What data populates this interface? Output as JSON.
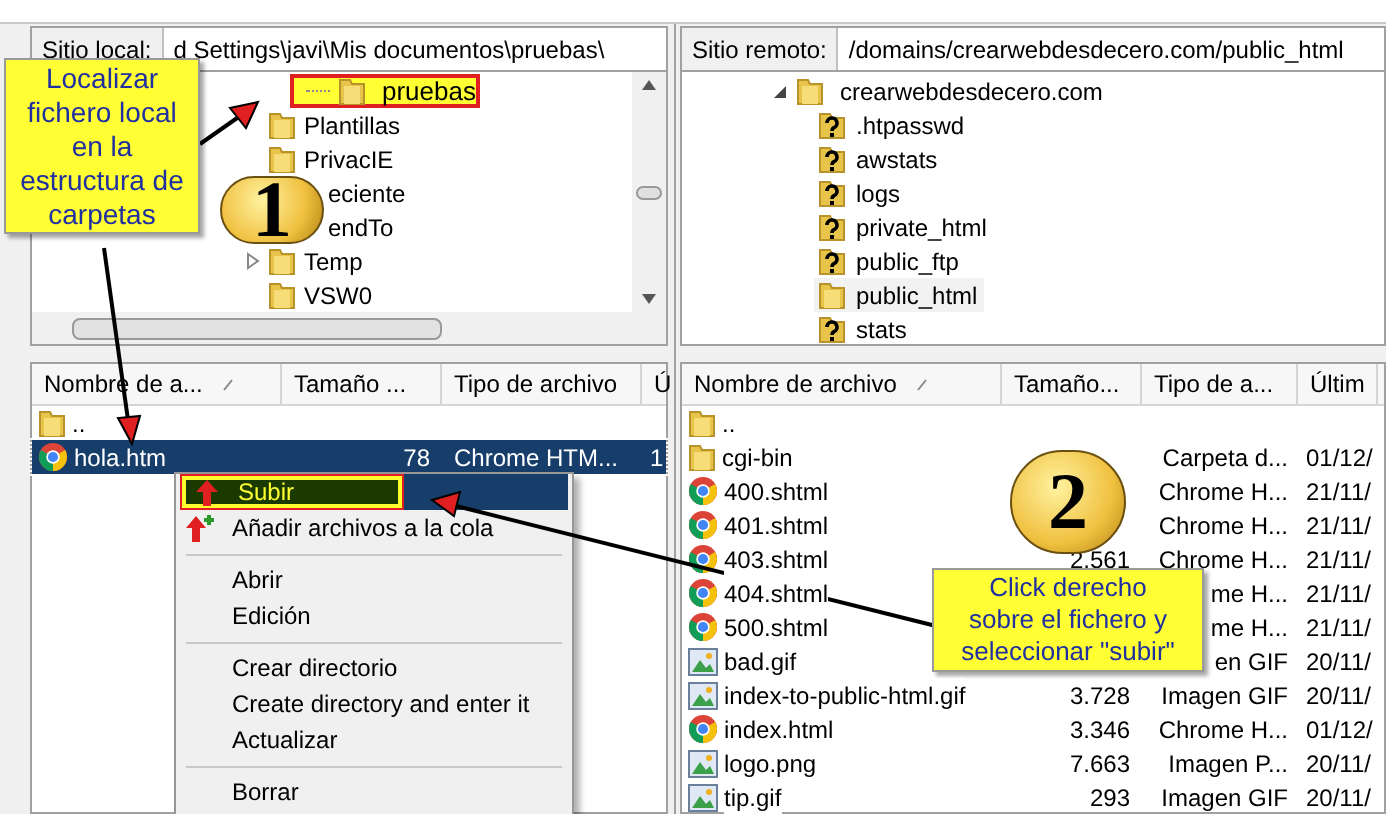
{
  "local_site": {
    "label": "Sitio local:",
    "path": "d Settings\\javi\\Mis documentos\\pruebas\\"
  },
  "local_tree": [
    {
      "name": "pruebas",
      "kind": "folder",
      "selected": true,
      "expandable": false
    },
    {
      "name": "Plantillas",
      "kind": "folder",
      "selected": false,
      "expandable": false
    },
    {
      "name": "PrivacIE",
      "kind": "folder",
      "selected": false,
      "expandable": false
    },
    {
      "name": "eciente",
      "kind": "covered",
      "selected": false,
      "expandable": false
    },
    {
      "name": "endTo",
      "kind": "covered",
      "selected": false,
      "expandable": false
    },
    {
      "name": "Temp",
      "kind": "folder",
      "selected": false,
      "expandable": true
    },
    {
      "name": "VSW0",
      "kind": "folder",
      "selected": false,
      "expandable": false
    }
  ],
  "remote_site": {
    "label": "Sitio remoto:",
    "path": "/domains/crearwebdesdecero.com/public_html"
  },
  "remote_tree": [
    {
      "name": "crearwebdesdecero.com",
      "kind": "folder",
      "expanded": true,
      "selected": false,
      "children": [
        {
          "name": ".htpasswd",
          "kind": "unknown",
          "selected": false
        },
        {
          "name": "awstats",
          "kind": "unknown",
          "selected": false
        },
        {
          "name": "logs",
          "kind": "unknown",
          "selected": false
        },
        {
          "name": "private_html",
          "kind": "unknown",
          "selected": false
        },
        {
          "name": "public_ftp",
          "kind": "unknown",
          "selected": false
        },
        {
          "name": "public_html",
          "kind": "folder",
          "selected": true
        },
        {
          "name": "stats",
          "kind": "unknown",
          "selected": false
        }
      ]
    }
  ],
  "local_files": {
    "columns": [
      "Nombre de a...",
      "Tamaño ...",
      "Tipo de archivo",
      "Ú"
    ],
    "rows": [
      {
        "name": "..",
        "kind": "folder",
        "selected": false
      },
      {
        "name": "hola.htm",
        "kind": "chrome",
        "size": "78",
        "type": "Chrome HTM...",
        "modified": "1",
        "selected": true
      }
    ]
  },
  "remote_files": {
    "columns": [
      "Nombre de archivo",
      "Tamaño...",
      "Tipo de a...",
      "Últim"
    ],
    "rows": [
      {
        "name": "..",
        "kind": "folder"
      },
      {
        "name": "cgi-bin",
        "kind": "folder",
        "type": "Carpeta d...",
        "modified": "01/12/"
      },
      {
        "name": "400.shtml",
        "kind": "chrome",
        "type": "Chrome H...",
        "modified": "21/11/"
      },
      {
        "name": "401.shtml",
        "kind": "chrome",
        "type": "Chrome H...",
        "modified": "21/11/"
      },
      {
        "name": "403.shtml",
        "kind": "chrome",
        "size": "2.561",
        "type": "Chrome H...",
        "modified": "21/11/"
      },
      {
        "name": "404.shtml",
        "kind": "chrome",
        "type": "me H...",
        "modified": "21/11/"
      },
      {
        "name": "500.shtml",
        "kind": "chrome",
        "type": "me H...",
        "modified": "21/11/"
      },
      {
        "name": "bad.gif",
        "kind": "image",
        "type": "en GIF",
        "modified": "20/11/"
      },
      {
        "name": "index-to-public-html.gif",
        "kind": "image",
        "size": "3.728",
        "type": "Imagen GIF",
        "modified": "20/11/"
      },
      {
        "name": "index.html",
        "kind": "chrome",
        "size": "3.346",
        "type": "Chrome H...",
        "modified": "01/12/"
      },
      {
        "name": "logo.png",
        "kind": "image",
        "size": "7.663",
        "type": "Imagen P...",
        "modified": "20/11/"
      },
      {
        "name": "tip.gif",
        "kind": "image",
        "size": "293",
        "type": "Imagen GIF",
        "modified": "20/11/"
      }
    ]
  },
  "context_menu": [
    {
      "kind": "upload",
      "label": "Subir",
      "selected": true
    },
    {
      "kind": "queue",
      "label": "Añadir archivos a la cola",
      "selected": false
    },
    {
      "kind": "separator"
    },
    {
      "kind": "item",
      "label": "Abrir",
      "selected": false
    },
    {
      "kind": "item",
      "label": "Edición",
      "selected": false
    },
    {
      "kind": "separator"
    },
    {
      "kind": "item",
      "label": "Crear directorio",
      "selected": false
    },
    {
      "kind": "item",
      "label": "Create directory and enter it",
      "selected": false
    },
    {
      "kind": "item",
      "label": "Actualizar",
      "selected": false
    },
    {
      "kind": "separator"
    },
    {
      "kind": "item",
      "label": "Borrar",
      "selected": false
    }
  ],
  "callouts": [
    {
      "lines": [
        "Localizar",
        "fichero local",
        "en la",
        "estructura de",
        "carpetas"
      ]
    },
    {
      "lines": [
        "Click derecho",
        "sobre el fichero y",
        "seleccionar \"subir\""
      ]
    }
  ],
  "step_badges": [
    "1",
    "2"
  ]
}
